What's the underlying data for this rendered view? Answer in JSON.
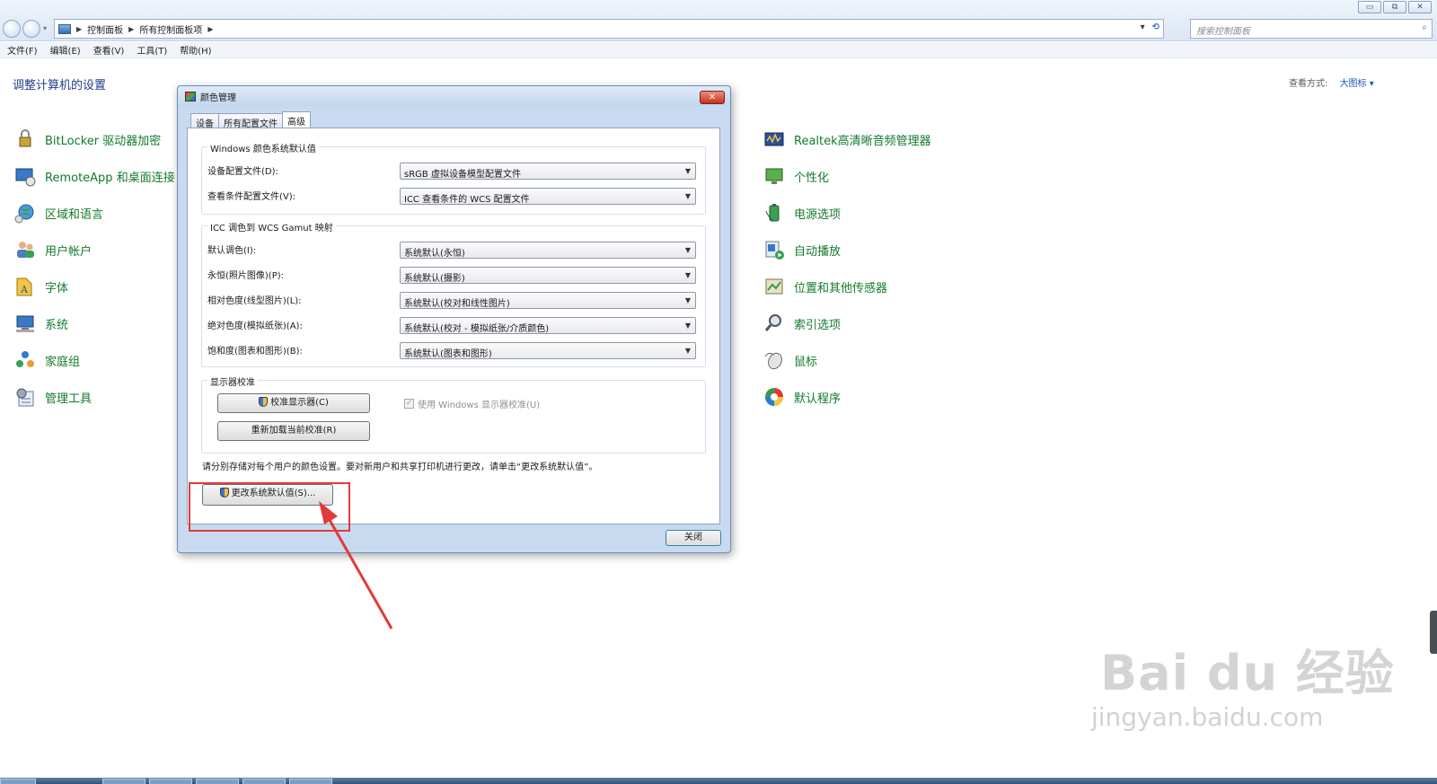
{
  "window": {
    "caption_buttons": [
      "▭",
      "⧉",
      "✕"
    ],
    "breadcrumb": [
      "控制面板",
      "所有控制面板项"
    ],
    "search_placeholder": "搜索控制面板"
  },
  "menu": [
    "文件(F)",
    "编辑(E)",
    "查看(V)",
    "工具(T)",
    "帮助(H)"
  ],
  "control_panel": {
    "heading": "调整计算机的设置",
    "view_by_label": "查看方式:",
    "view_by_value": "大图标 ▾",
    "left_items": [
      {
        "label": "BitLocker 驱动器加密",
        "icon": "bitlocker-icon"
      },
      {
        "label": "RemoteApp 和桌面连接",
        "icon": "remoteapp-icon"
      },
      {
        "label": "区域和语言",
        "icon": "globe-icon"
      },
      {
        "label": "用户帐户",
        "icon": "users-icon"
      },
      {
        "label": "字体",
        "icon": "font-icon"
      },
      {
        "label": "系统",
        "icon": "system-icon"
      },
      {
        "label": "家庭组",
        "icon": "homegroup-icon"
      },
      {
        "label": "管理工具",
        "icon": "admin-tools-icon"
      }
    ],
    "right_items": [
      {
        "label": "Realtek高清晰音频管理器",
        "icon": "audio-manager-icon"
      },
      {
        "label": "个性化",
        "icon": "personalize-icon"
      },
      {
        "label": "电源选项",
        "icon": "power-icon"
      },
      {
        "label": "自动播放",
        "icon": "autoplay-icon"
      },
      {
        "label": "位置和其他传感器",
        "icon": "sensor-icon"
      },
      {
        "label": "索引选项",
        "icon": "index-icon"
      },
      {
        "label": "鼠标",
        "icon": "mouse-icon"
      },
      {
        "label": "默认程序",
        "icon": "default-programs-icon"
      }
    ]
  },
  "dialog": {
    "title": "颜色管理",
    "close": "✕",
    "tabs": [
      "设备",
      "所有配置文件",
      "高级"
    ],
    "active_tab": "高级",
    "windows_defaults": {
      "title": "Windows 颜色系统默认值",
      "rows": [
        {
          "label": "设备配置文件(D):",
          "value": "sRGB 虚拟设备模型配置文件"
        },
        {
          "label": "查看条件配置文件(V):",
          "value": "ICC 查看条件的 WCS 配置文件"
        }
      ]
    },
    "gamut": {
      "title": "ICC 调色到 WCS Gamut 映射",
      "rows": [
        {
          "label": "默认调色(I):",
          "value": "系统默认(永恒)"
        },
        {
          "label": "永恒(照片图像)(P):",
          "value": "系统默认(摄影)"
        },
        {
          "label": "相对色度(线型图片)(L):",
          "value": "系统默认(校对和线性图片)"
        },
        {
          "label": "绝对色度(模拟纸张)(A):",
          "value": "系统默认(校对 - 模拟纸张/介质颜色)"
        },
        {
          "label": "饱和度(图表和图形)(B):",
          "value": "系统默认(图表和图形)"
        }
      ]
    },
    "calibration": {
      "title": "显示器校准",
      "calibrate_btn": "校准显示器(C)",
      "reload_btn": "重新加载当前校准(R)",
      "use_windows_label": "使用 Windows 显示器校准(U)",
      "use_windows_checked": true
    },
    "info_text": "请分别存储对每个用户的颜色设置。要对新用户和共享打印机进行更改，请单击“更改系统默认值”。",
    "change_defaults_btn": "更改系统默认值(S)...",
    "close_btn": "关闭"
  },
  "watermark": {
    "top": "Bai du 经验",
    "bottom": "jingyan.baidu.com"
  },
  "colors": {
    "accent_link": "#137a2c",
    "heading": "#1e3f8a",
    "highlight": "#e23a3a"
  }
}
